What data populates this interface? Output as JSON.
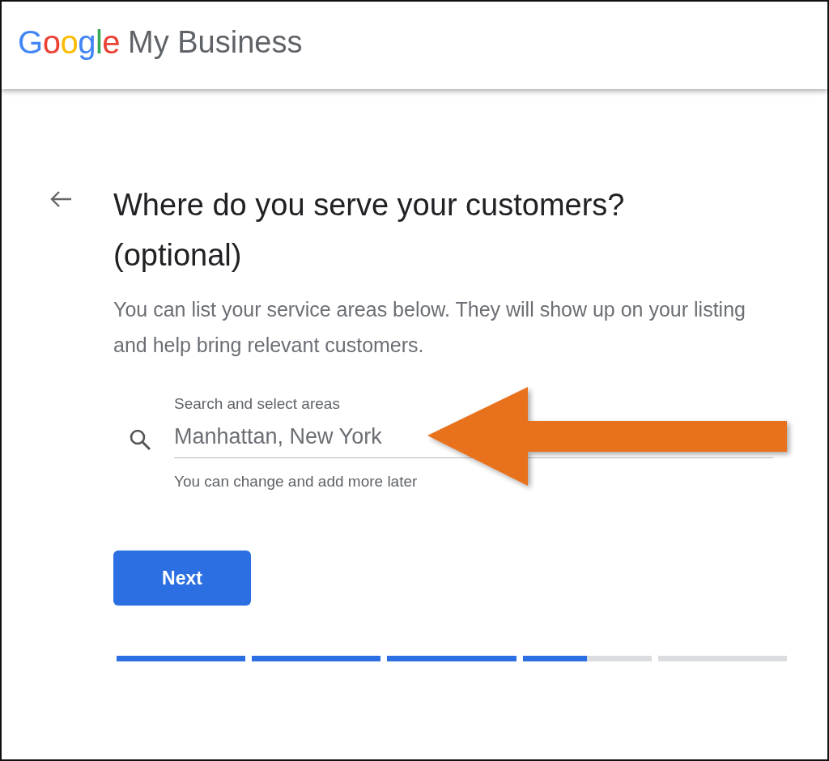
{
  "header": {
    "logo_letters": [
      "G",
      "o",
      "o",
      "g",
      "l",
      "e"
    ],
    "product": "My Business"
  },
  "title": "Where do you serve your customers? (optional)",
  "description": "You can list your service areas below. They will show up on your listing and help bring relevant customers.",
  "field": {
    "label": "Search and select areas",
    "value": "Manhattan, New York",
    "helper": "You can change and add more later"
  },
  "next_button": "Next",
  "progress": [
    {
      "level": 1
    },
    {
      "level": 1
    },
    {
      "level": 1
    },
    {
      "level": 0.5
    },
    {
      "level": 0
    }
  ]
}
